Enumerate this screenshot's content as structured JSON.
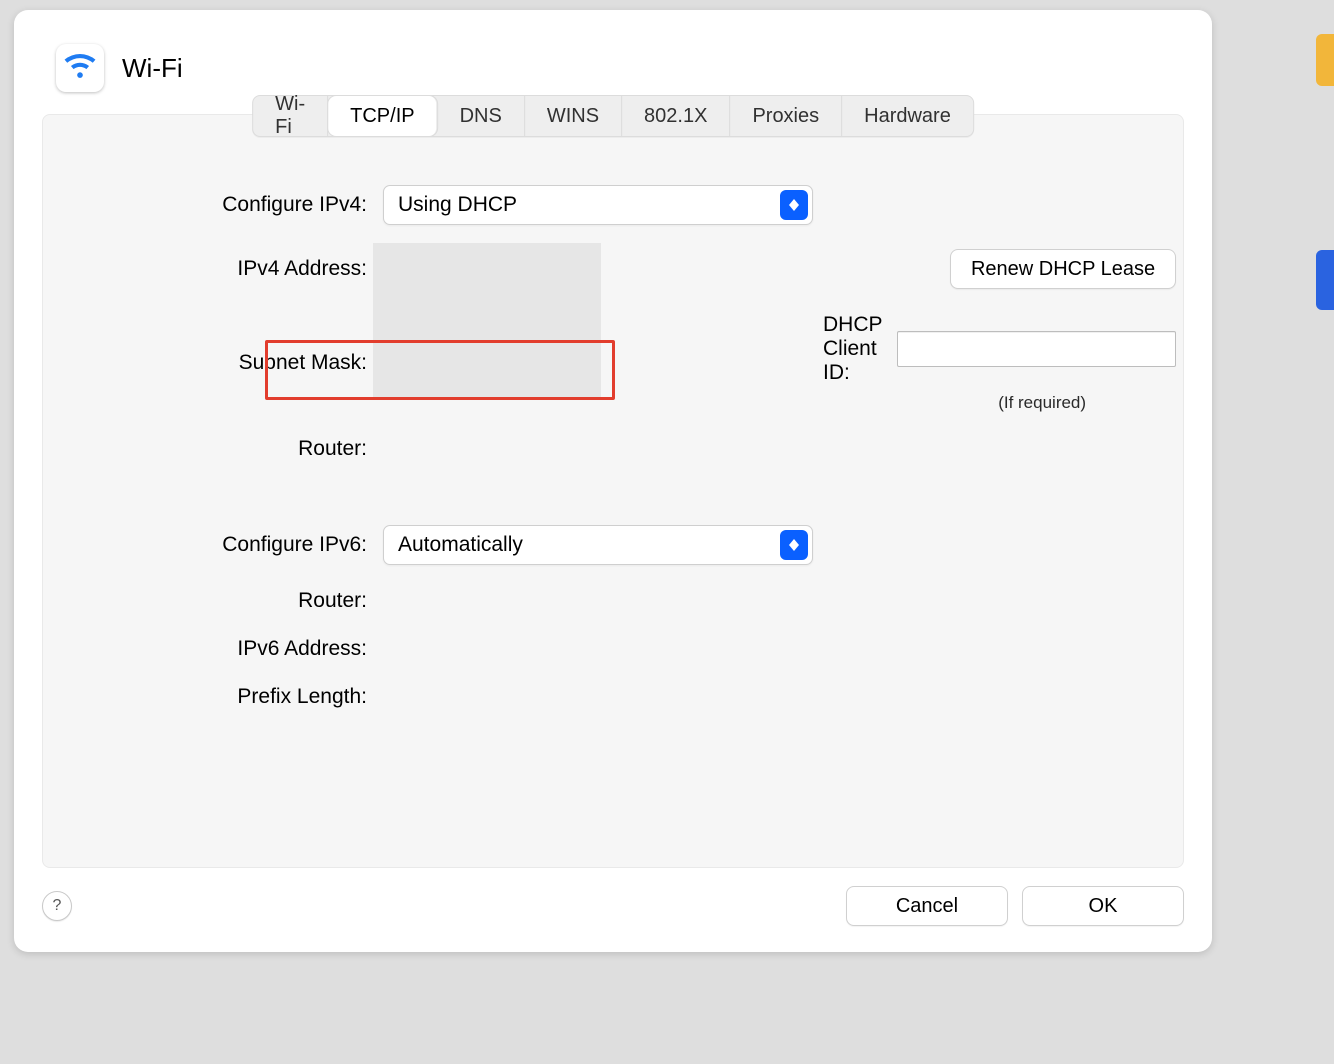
{
  "header": {
    "title": "Wi-Fi"
  },
  "tabs": {
    "items": [
      "Wi-Fi",
      "TCP/IP",
      "DNS",
      "WINS",
      "802.1X",
      "Proxies",
      "Hardware"
    ],
    "active": 1
  },
  "ipv4": {
    "configure_label": "Configure IPv4:",
    "configure_value": "Using DHCP",
    "address_label": "IPv4 Address:",
    "subnet_label": "Subnet Mask:",
    "router_label": "Router:",
    "renew_button": "Renew DHCP Lease",
    "dhcp_client_id_label": "DHCP Client ID:",
    "dhcp_client_id_value": "",
    "if_required": "(If required)"
  },
  "ipv6": {
    "configure_label": "Configure IPv6:",
    "configure_value": "Automatically",
    "router_label": "Router:",
    "address_label": "IPv6 Address:",
    "prefix_label": "Prefix Length:"
  },
  "footer": {
    "help": "?",
    "cancel": "Cancel",
    "ok": "OK"
  }
}
